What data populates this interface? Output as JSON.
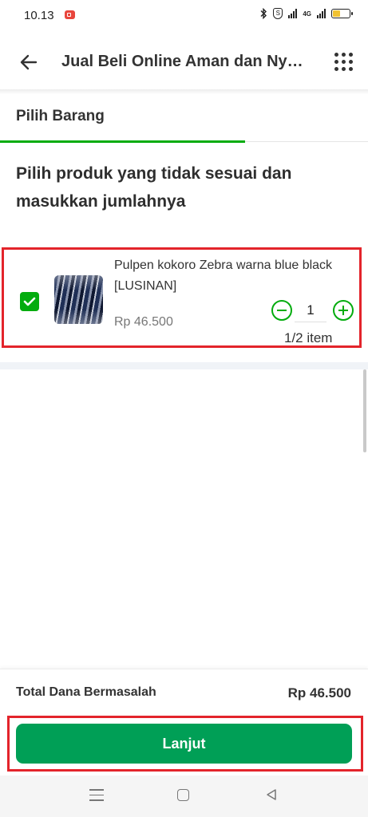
{
  "status_bar": {
    "time": "10.13",
    "network_label": "4G"
  },
  "header": {
    "title": "Jual Beli Online Aman dan Nyaman"
  },
  "tabs": [
    {
      "label": "Pilih Barang",
      "active": true
    }
  ],
  "heading": "Pilih produk yang tidak sesuai dan masukkan jumlahnya",
  "product": {
    "checked": true,
    "name": "Pulpen kokoro Zebra warna blue black [LUSINAN]",
    "price": "Rp 46.500",
    "quantity": "1",
    "quantity_note": "1/2 item"
  },
  "summary": {
    "label": "Total Dana Bermasalah",
    "value": "Rp 46.500"
  },
  "primary_button": {
    "label": "Lanjut"
  },
  "colors": {
    "accent": "#03ac0e",
    "button": "#009f56",
    "highlight_border": "#e3242b"
  },
  "icons": [
    "back-arrow-icon",
    "grid-menu-icon",
    "checkmark-icon",
    "minus-icon",
    "plus-icon",
    "bluetooth-icon",
    "signal-icon",
    "battery-icon"
  ]
}
